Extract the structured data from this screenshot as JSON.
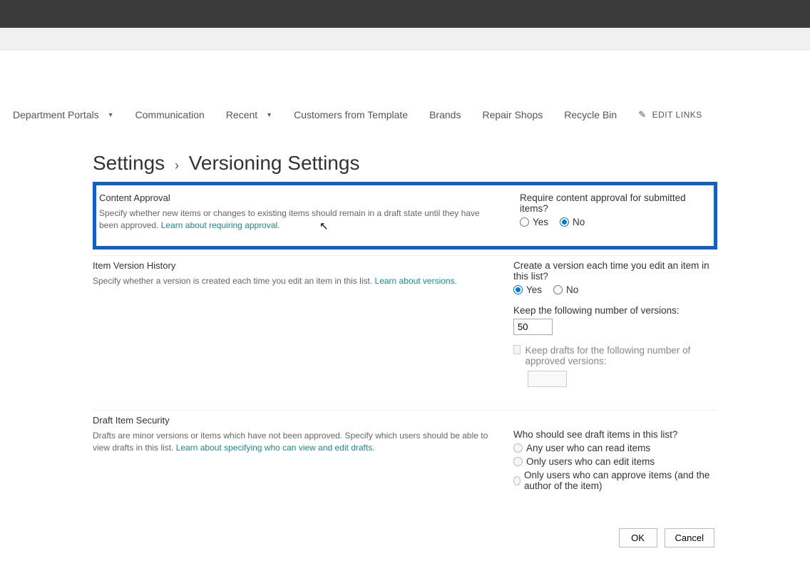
{
  "nav": {
    "items": [
      {
        "label": "Department Portals",
        "hasDropdown": true
      },
      {
        "label": "Communication",
        "hasDropdown": false
      },
      {
        "label": "Recent",
        "hasDropdown": true
      },
      {
        "label": "Customers from Template",
        "hasDropdown": false
      },
      {
        "label": "Brands",
        "hasDropdown": false
      },
      {
        "label": "Repair Shops",
        "hasDropdown": false
      },
      {
        "label": "Recycle Bin",
        "hasDropdown": false
      }
    ],
    "editLinks": "EDIT LINKS"
  },
  "breadcrumb": {
    "root": "Settings",
    "page": "Versioning Settings"
  },
  "sections": {
    "contentApproval": {
      "title": "Content Approval",
      "desc": "Specify whether new items or changes to existing items should remain in a draft state until they have been approved.  ",
      "link": "Learn about requiring approval.",
      "question": "Require content approval for submitted items?",
      "yes": "Yes",
      "no": "No",
      "selected": "No"
    },
    "versionHistory": {
      "title": "Item Version History",
      "desc": "Specify whether a version is created each time you edit an item in this list.  ",
      "link": "Learn about versions.",
      "q1": "Create a version each time you edit an item in this list?",
      "q1_yes": "Yes",
      "q1_no": "No",
      "q1_selected": "Yes",
      "keepVersionsLabel": "Keep the following number of versions:",
      "keepVersionsValue": "50",
      "keepDraftsLabel": "Keep drafts for the following number of approved versions:",
      "keepDraftsChecked": false,
      "keepDraftsValue": ""
    },
    "draftSecurity": {
      "title": "Draft Item Security",
      "desc": "Drafts are minor versions or items which have not been approved. Specify which users should be able to view drafts in this list.  ",
      "link": "Learn about specifying who can view and edit drafts.",
      "question": "Who should see draft items in this list?",
      "opt1": "Any user who can read items",
      "opt2": "Only users who can edit items",
      "opt3": "Only users who can approve items (and the author of the item)",
      "selected": ""
    }
  },
  "buttons": {
    "ok": "OK",
    "cancel": "Cancel"
  }
}
